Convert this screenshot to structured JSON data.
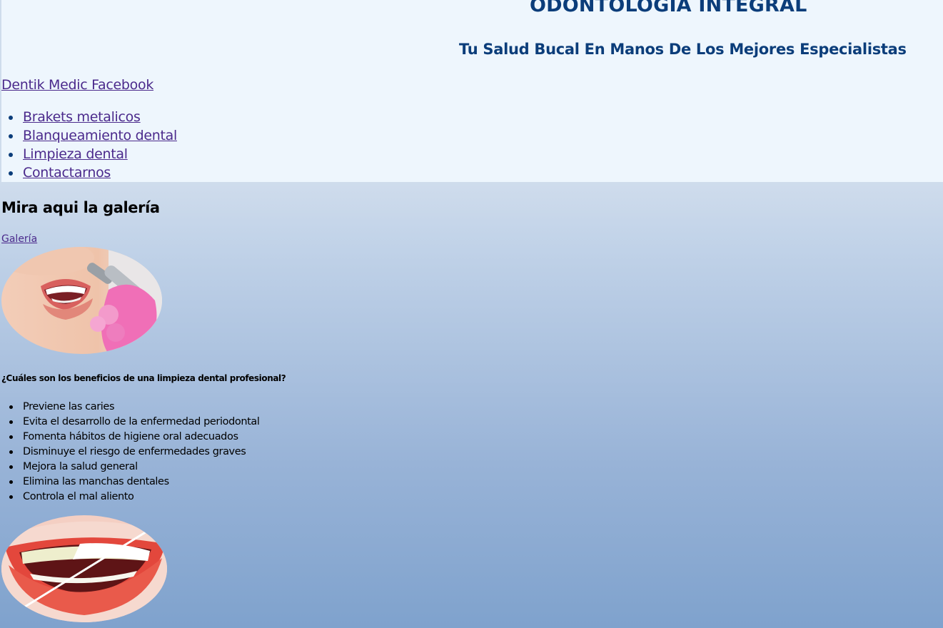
{
  "header": {
    "title": "ODONTOLOGÍA INTEGRAL",
    "subtitle": "Tu Salud Bucal En Manos De Los Mejores Especialistas",
    "facebook_link": "Dentik Medic Facebook",
    "nav": [
      {
        "label": "Brakets metalicos"
      },
      {
        "label": "Blanqueamiento dental"
      },
      {
        "label": "Limpieza dental"
      },
      {
        "label": "Contactarnos"
      }
    ]
  },
  "gallery": {
    "heading": "Mira aqui la galería",
    "link": "Galería"
  },
  "benefits": {
    "heading": "¿Cuáles son los beneficios de una limpieza dental profesional?",
    "items": [
      "Previene las caries",
      "Evita el desarrollo de la enfermedad periodontal",
      "Fomenta hábitos de higiene oral adecuados",
      "Disminuye el riesgo de enfermedades graves",
      "Mejora la salud general",
      "Elimina las manchas dentales",
      "Controla el mal aliento"
    ]
  },
  "colors": {
    "header_bg": "#eef6fd",
    "title": "#0b3d7a",
    "link": "#4b2a8c",
    "body_gradient_top": "#cfdcec",
    "body_gradient_bottom": "#7fa2cd"
  },
  "images": {
    "cleaning": "dental-cleaning-photo",
    "whitening": "teeth-whitening-photo"
  }
}
